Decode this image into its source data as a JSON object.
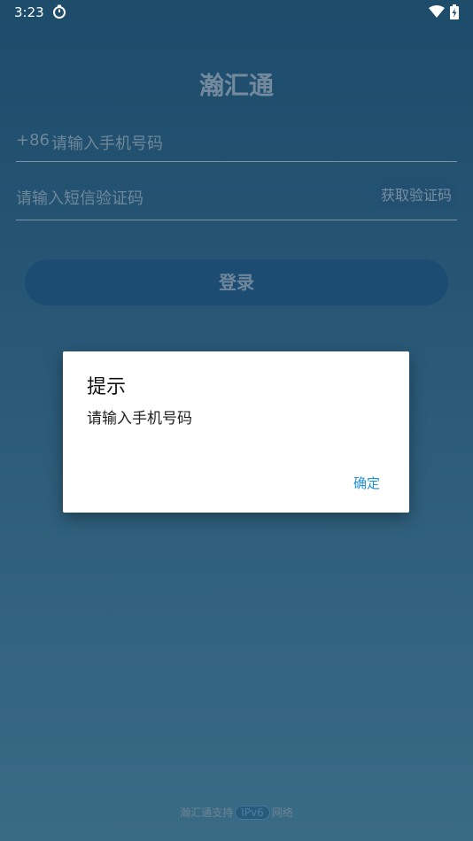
{
  "status_bar": {
    "time": "3:23",
    "icons": [
      "timer-icon",
      "wifi-icon",
      "battery-charging-icon"
    ]
  },
  "app": {
    "title": "瀚汇通"
  },
  "login": {
    "phone_prefix": "+86",
    "phone_placeholder": "请输入手机号码",
    "code_placeholder": "请输入短信验证码",
    "get_code_label": "获取验证码",
    "login_label": "登录"
  },
  "dialog": {
    "title": "提示",
    "message": "请输入手机号码",
    "ok_label": "确定"
  },
  "footer": {
    "prefix": "瀚汇通支持",
    "badge": "IPv6",
    "suffix": "网络"
  },
  "colors": {
    "background_top": "#1d4b6b",
    "background_bottom": "#3a6b85",
    "accent": "#1f90d6",
    "dialog_bg": "#ffffff"
  }
}
